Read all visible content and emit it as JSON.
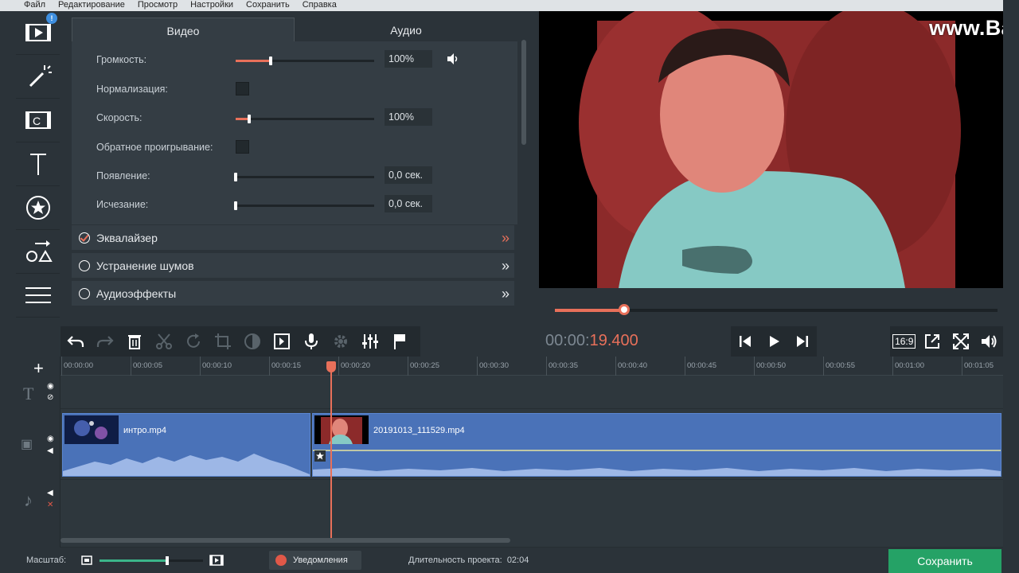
{
  "menu": [
    "Файл",
    "Редактирование",
    "Просмотр",
    "Настройки",
    "Сохранить",
    "Справка"
  ],
  "left_tools": {
    "badge": "!",
    "items": [
      "import-icon",
      "magic-wand-icon",
      "filters-icon",
      "titles-icon",
      "stickers-icon",
      "transitions-icon",
      "more-list-icon"
    ]
  },
  "tabs": {
    "video": "Видео",
    "audio": "Аудио"
  },
  "props": {
    "volume": {
      "label": "Громкость:",
      "value": "100%",
      "level": 0.25
    },
    "normalize": {
      "label": "Нормализация:",
      "checked": false
    },
    "speed": {
      "label": "Скорость:",
      "value": "100%",
      "level": 0.1
    },
    "reverse": {
      "label": "Обратное проигрывание:",
      "checked": false
    },
    "fade_in": {
      "label": "Появление:",
      "value": "0,0 сек.",
      "level": 0
    },
    "fade_out": {
      "label": "Исчезание:",
      "value": "0,0 сек.",
      "level": 0
    }
  },
  "sections": [
    {
      "label": "Эквалайзер",
      "checked": true
    },
    {
      "label": "Устранение шумов",
      "checked": false
    },
    {
      "label": "Аудиоэффекты",
      "checked": false
    }
  ],
  "watermark": "www.Bandicam.com",
  "playback": {
    "progress": 0.156
  },
  "timecode": {
    "base": "00:00:",
    "current": "19.400"
  },
  "aspect": "16:9",
  "ruler": [
    "00:00:00",
    "00:00:05",
    "00:00:10",
    "00:00:15",
    "00:00:20",
    "00:00:25",
    "00:00:30",
    "00:00:35",
    "00:00:40",
    "00:00:45",
    "00:00:50",
    "00:00:55",
    "00:01:00",
    "00:01:05"
  ],
  "clips": [
    {
      "name": "интро.mp4"
    },
    {
      "name": "20191013_111529.mp4"
    }
  ],
  "status": {
    "zoom_label": "Масштаб:",
    "zoom_level": 0.65,
    "notifications": "Уведомления",
    "duration_label": "Длительность проекта:",
    "duration": "02:04",
    "save": "Сохранить"
  },
  "colors": {
    "accent": "#e8705a",
    "clip": "#4a72b8",
    "save": "#25a266"
  }
}
